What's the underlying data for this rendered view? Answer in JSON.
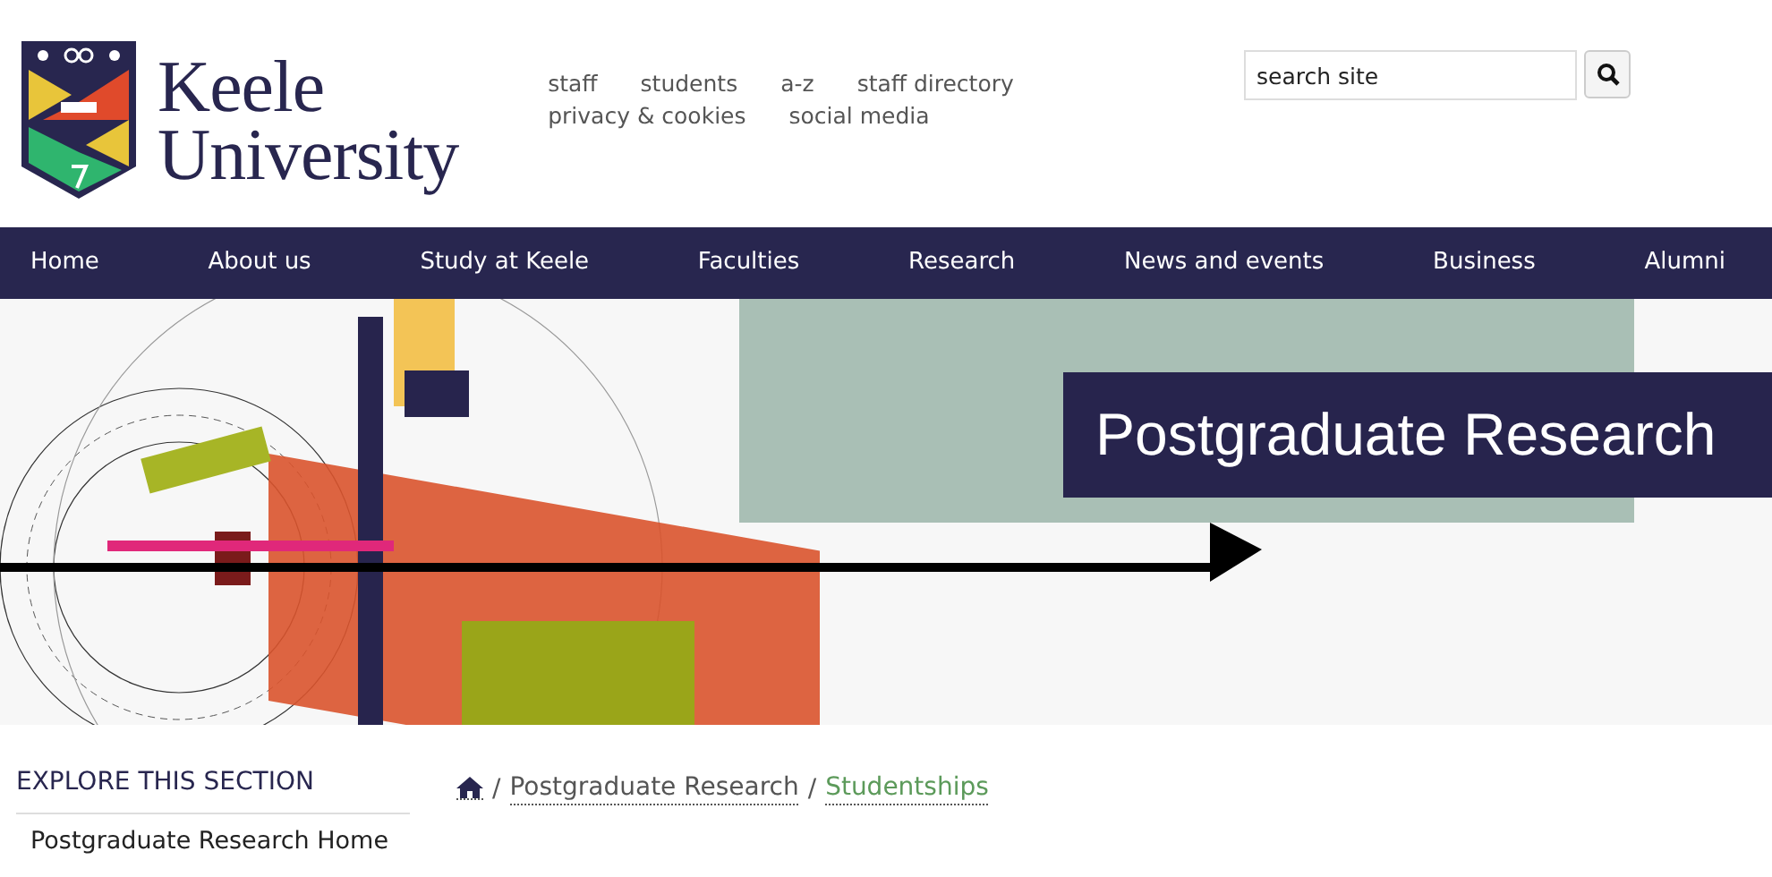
{
  "logo": {
    "lines": [
      "Keele",
      "University"
    ]
  },
  "utility_links": [
    [
      "staff",
      "students",
      "a-z",
      "staff directory"
    ],
    [
      "privacy & cookies",
      "social media"
    ]
  ],
  "search": {
    "placeholder": "search site"
  },
  "nav": [
    {
      "label": "Home"
    },
    {
      "label": "About us"
    },
    {
      "label": "Study at Keele"
    },
    {
      "label": "Faculties"
    },
    {
      "label": "Research"
    },
    {
      "label": "News and events"
    },
    {
      "label": "Business"
    },
    {
      "label": "Alumni"
    }
  ],
  "banner": {
    "title": "Postgraduate Research"
  },
  "sidebar": {
    "heading": "EXPLORE THIS SECTION",
    "items": [
      {
        "label": "Postgraduate Research Home"
      }
    ]
  },
  "breadcrumb": {
    "separator": "/",
    "items": [
      {
        "kind": "home"
      },
      {
        "kind": "link",
        "label": "Postgraduate Research"
      },
      {
        "kind": "current",
        "label": "Studentships"
      }
    ]
  }
}
